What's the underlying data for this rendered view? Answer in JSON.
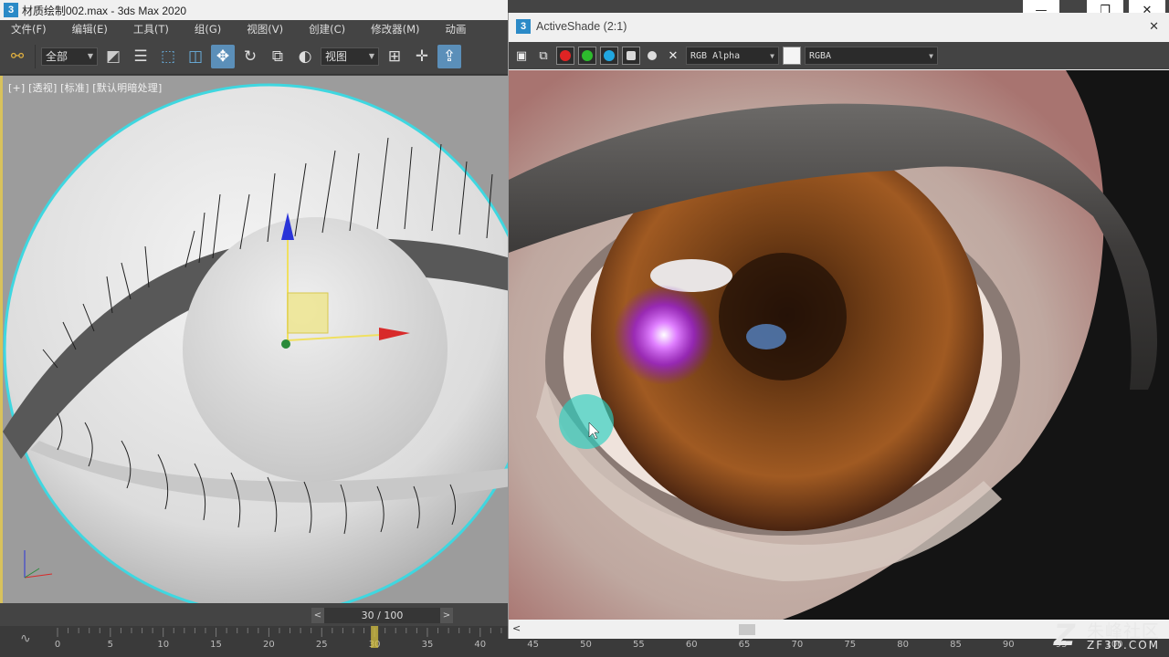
{
  "main_window": {
    "title": "材质绘制002.max - 3ds Max 2020",
    "app_icon_text": "3"
  },
  "menu": [
    "文件(F)",
    "编辑(E)",
    "工具(T)",
    "组(G)",
    "视图(V)",
    "创建(C)",
    "修改器(M)",
    "动画"
  ],
  "toolbar": {
    "selection_filter": "全部",
    "ref_coord": "视图"
  },
  "viewport": {
    "label": "[+] [透视] [标准] [默认明暗处理]"
  },
  "time_slider": {
    "prev": "<",
    "display": "30 / 100",
    "next": ">",
    "current_frame": 30,
    "total_frames": 100
  },
  "timeline_ticks": [
    "0",
    "5",
    "10",
    "15",
    "20",
    "25",
    "30",
    "35",
    "40",
    "45",
    "50",
    "55",
    "60",
    "65",
    "70",
    "75",
    "80",
    "85",
    "90",
    "95",
    "100"
  ],
  "activeshade": {
    "title": "ActiveShade (2:1)",
    "app_icon_text": "3",
    "channel_display": "RGB Alpha",
    "render_mode": "RGBA"
  },
  "window_controls": {
    "minimize": "—",
    "restore": "❐",
    "close": "✕"
  },
  "watermark": {
    "cn": "朱峰社区",
    "en": "ZF3D.COM",
    "logo": "Z"
  },
  "colors": {
    "accent_active": "#5b8fb9",
    "viewport_bg": "#a6a6a6",
    "ui_dark": "#444444",
    "iris": "#8a4a1c",
    "selection_ring": "#3fd7e0"
  }
}
